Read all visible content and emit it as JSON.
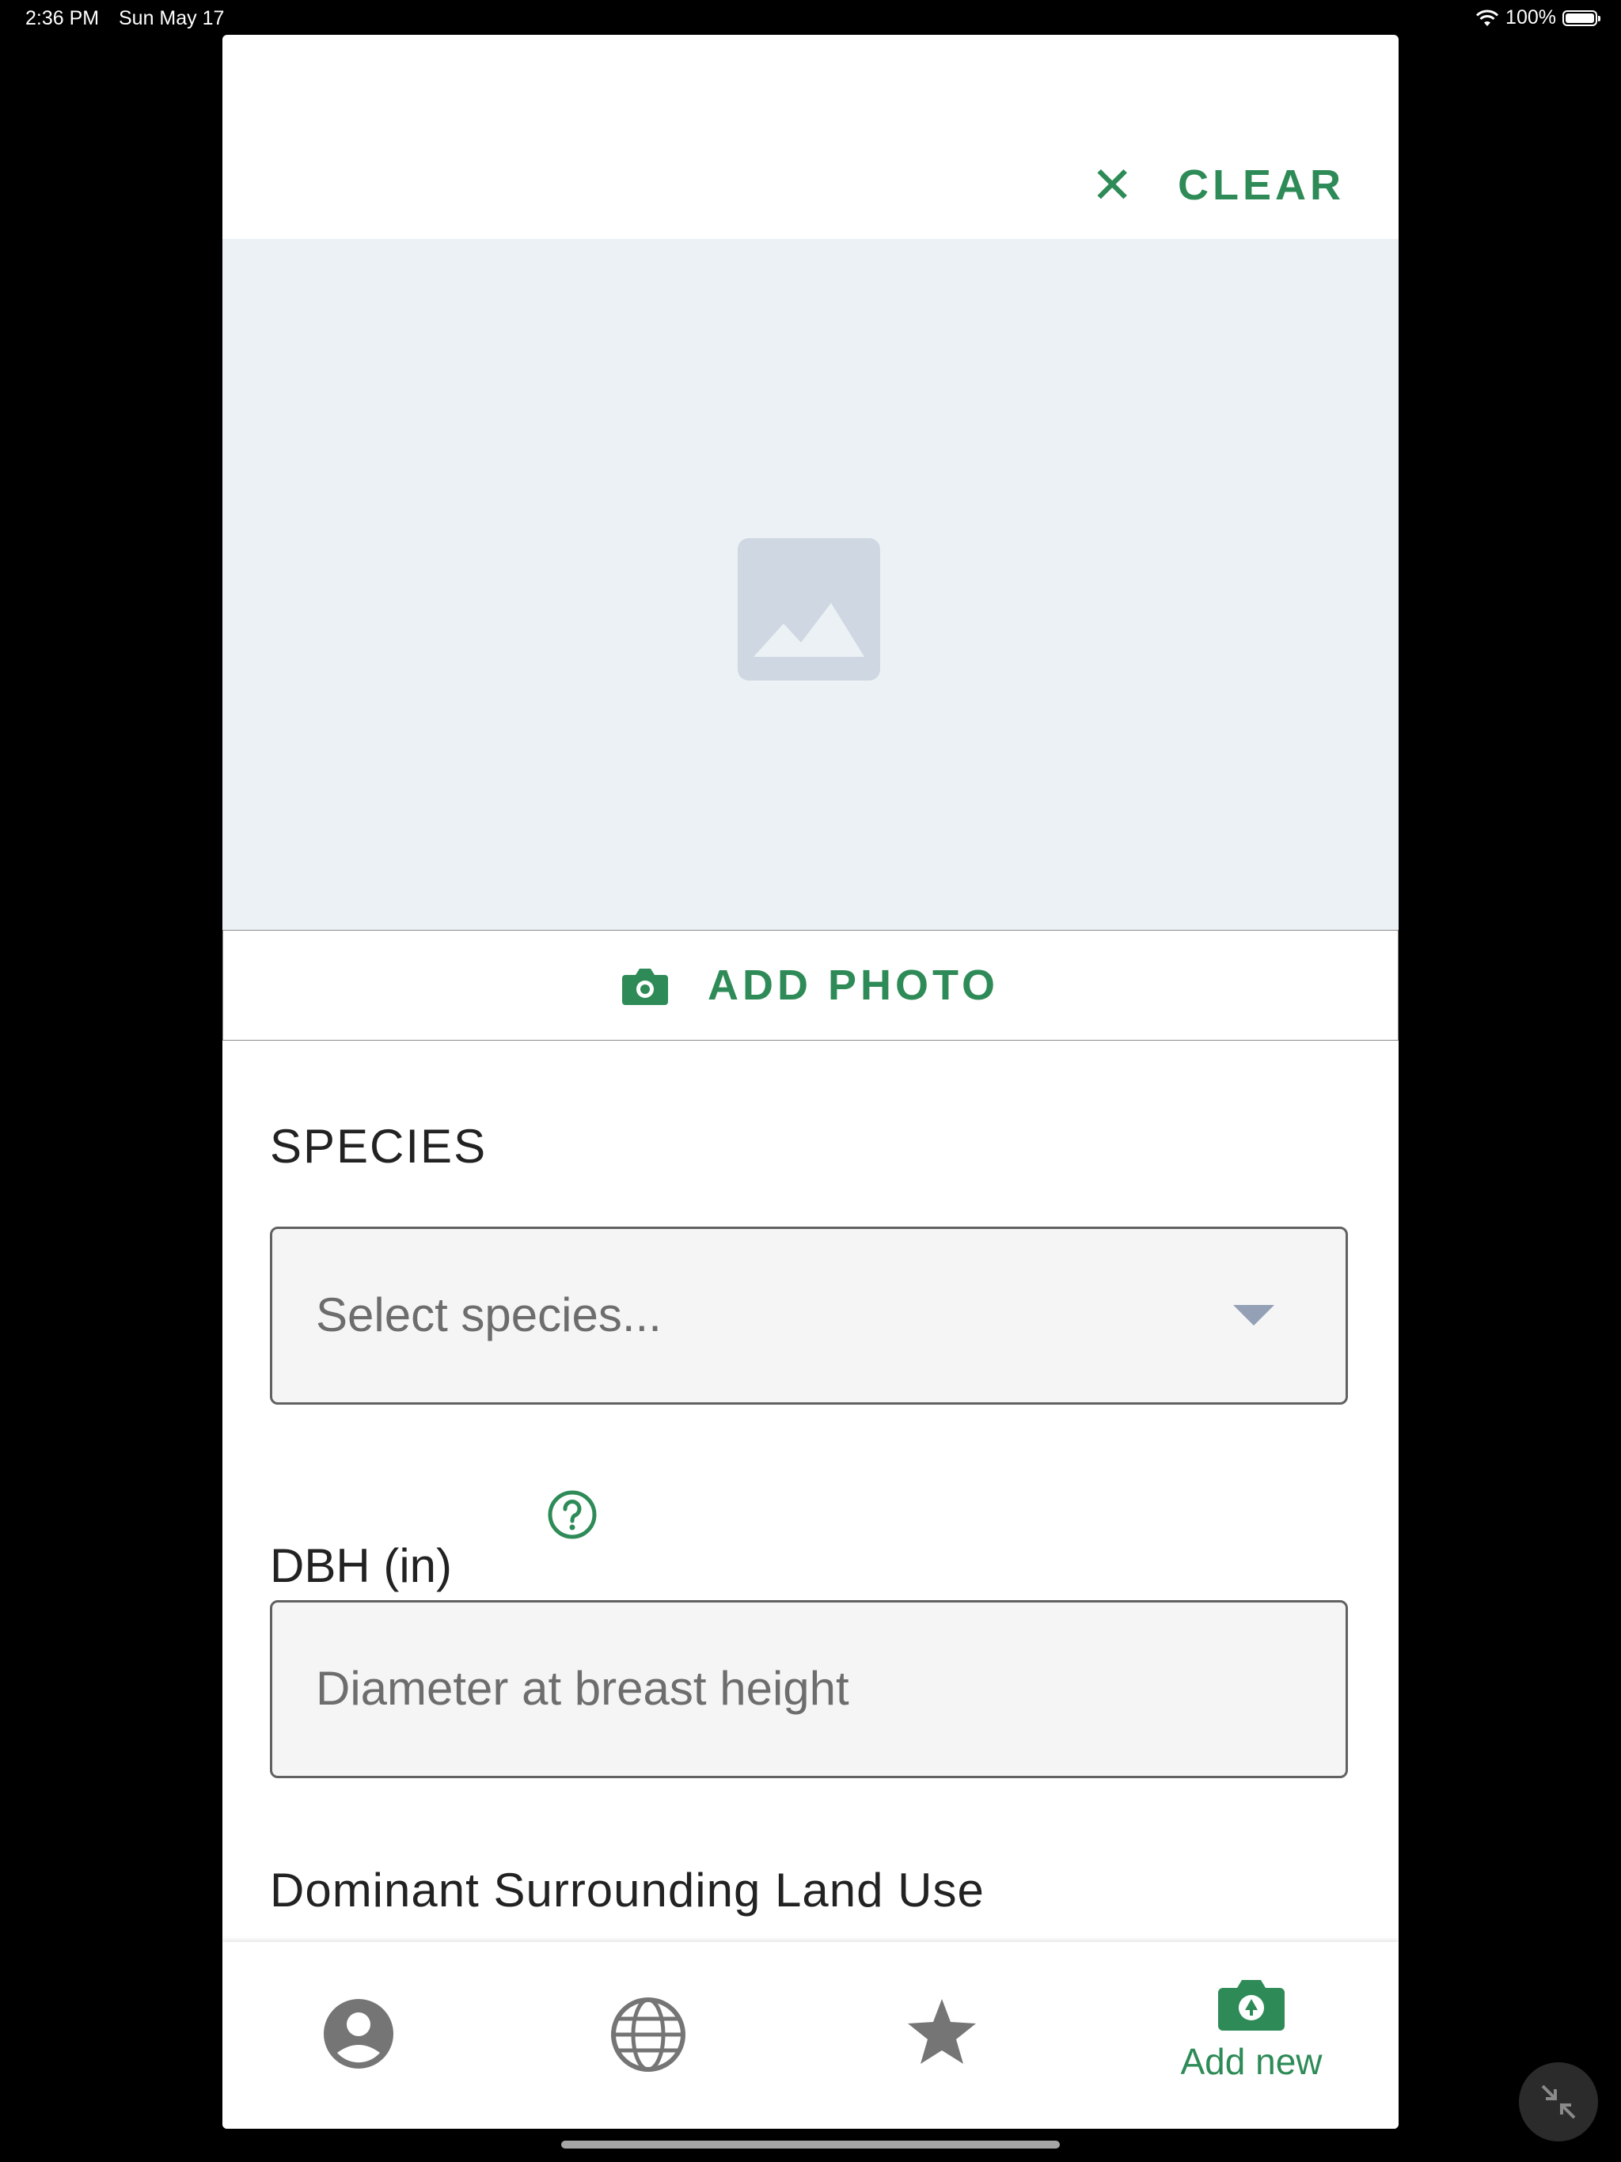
{
  "status_bar": {
    "time": "2:36 PM",
    "date": "Sun May 17",
    "battery": "100%"
  },
  "header": {
    "clear_label": "CLEAR"
  },
  "photo": {
    "add_photo_label": "ADD PHOTO"
  },
  "form": {
    "species_label": "SPECIES",
    "species_placeholder": "Select species...",
    "dbh_label": "DBH (in)",
    "dbh_placeholder": "Diameter at breast height",
    "land_use_label": "Dominant Surrounding Land Use"
  },
  "tabbar": {
    "tabs": [
      {
        "icon": "profile-icon"
      },
      {
        "icon": "globe-icon"
      },
      {
        "icon": "star-icon"
      },
      {
        "icon": "camera-tree-icon",
        "label": "Add new",
        "active": true
      }
    ]
  },
  "colors": {
    "accent": "#2e8b57",
    "placeholder_bg": "#ecf1f5",
    "inactive_icon": "#757575"
  }
}
